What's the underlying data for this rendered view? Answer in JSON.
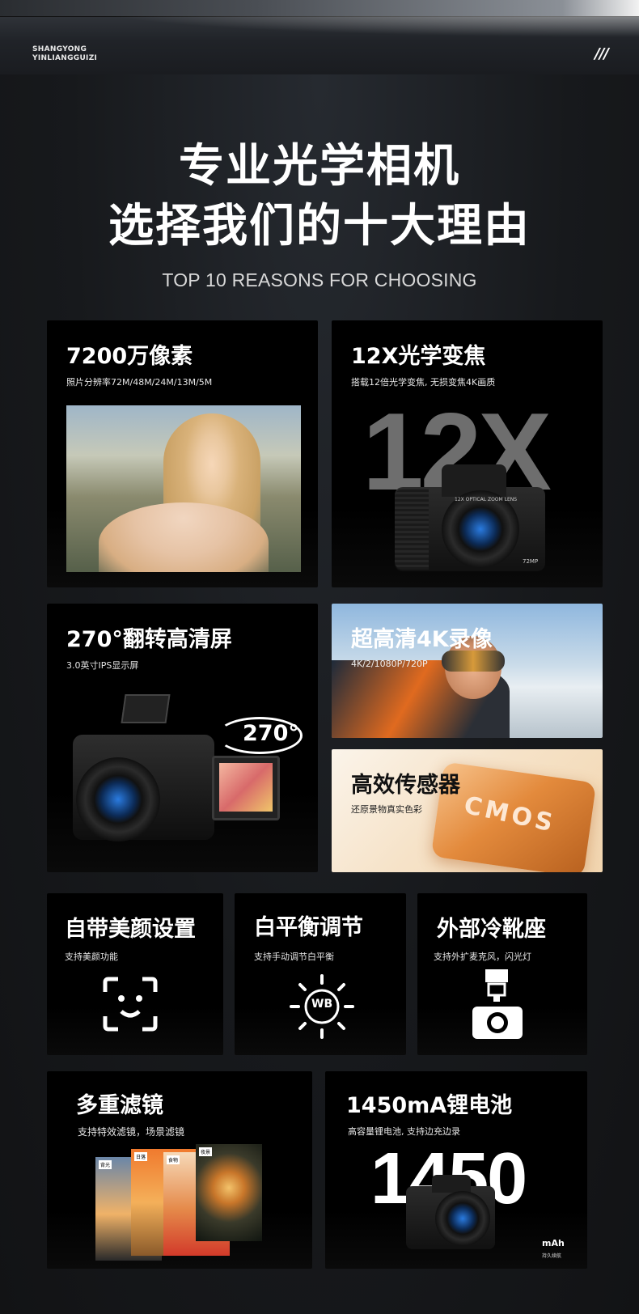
{
  "header": {
    "brand_line1": "SHANGYONG",
    "brand_line2": "YINLIANGGUIZI",
    "mark": "///"
  },
  "hero": {
    "title_line1": "专业光学相机",
    "title_line2": "选择我们的十大理由",
    "subtitle": "TOP 10 REASONS FOR CHOOSING"
  },
  "cards": {
    "megapixel": {
      "title": "7200万像素",
      "desc": "照片分辨率72M/48M/24M/13M/5M"
    },
    "zoom": {
      "title": "12X光学变焦",
      "desc": "搭载12倍光学变焦, 无损变焦4K画质",
      "big": "12X",
      "lens_text": "12X OPTICAL ZOOM LENS",
      "mp_text": "72MP"
    },
    "screen": {
      "title": "270°翻转高清屏",
      "desc": "3.0英寸IPS显示屏",
      "badge": "270°"
    },
    "video": {
      "title": "超高清4K录像",
      "desc": "4K/2/1080P/720P"
    },
    "sensor": {
      "title": "高效传感器",
      "desc": "还原景物真实色彩",
      "chip": "CMOS"
    },
    "beauty": {
      "title": "自带美颜设置",
      "desc": "支持美颜功能"
    },
    "wb": {
      "title": "白平衡调节",
      "desc": "支持手动调节白平衡",
      "icon_text": "WB"
    },
    "shoe": {
      "title": "外部冷靴座",
      "desc": "支持外扩麦克风，闪光灯"
    },
    "filters": {
      "title": "多重滤镜",
      "desc": "支持特效滤镜，场景滤镜",
      "tags": [
        "背光",
        "日落",
        "食物",
        "夜景"
      ]
    },
    "battery": {
      "title": "1450mA锂电池",
      "desc": "高容量锂电池, 支持边充边录",
      "big": "1450",
      "unit": "mAh",
      "unit_sub": "持久续航"
    }
  },
  "colors": {
    "accent_blue": "#2a7be0",
    "background": "#16181b",
    "card": "#000000"
  }
}
